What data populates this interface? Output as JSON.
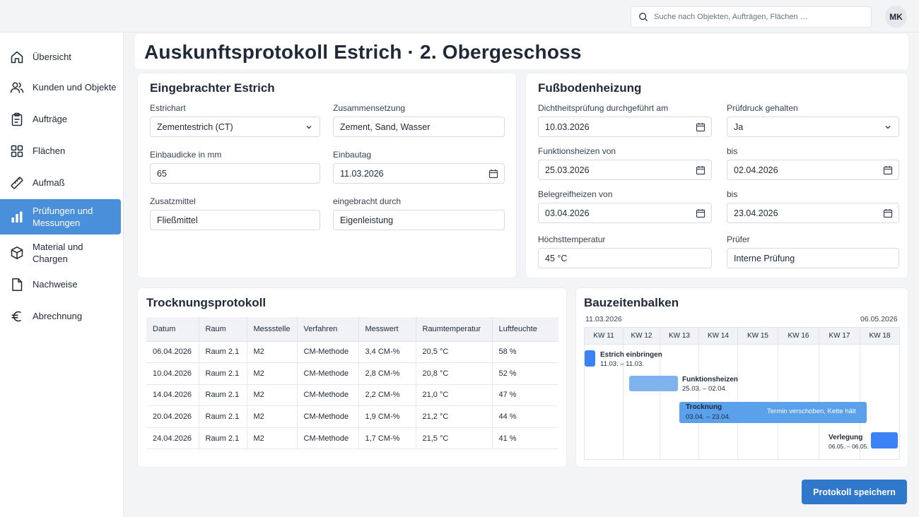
{
  "search": {
    "placeholder": "Suche nach Objekten, Aufträgen, Flächen …"
  },
  "user": {
    "initials": "MK"
  },
  "sidebar": {
    "items": [
      {
        "label": "Übersicht",
        "icon": "home-icon"
      },
      {
        "label": "Kunden und Objekte",
        "icon": "users-icon"
      },
      {
        "label": "Aufträge",
        "icon": "clipboard-icon"
      },
      {
        "label": "Flächen",
        "icon": "grid-icon"
      },
      {
        "label": "Aufmaß",
        "icon": "ruler-icon"
      },
      {
        "label": "Prüfungen und Messungen",
        "icon": "bar-chart-icon",
        "active": true
      },
      {
        "label": "Material und Chargen",
        "icon": "box-icon"
      },
      {
        "label": "Nachweise",
        "icon": "document-icon"
      },
      {
        "label": "Abrechnung",
        "icon": "euro-icon"
      }
    ]
  },
  "page": {
    "title": "Auskunftsprotokoll Estrich · 2. Obergeschoss"
  },
  "estrich": {
    "title": "Eingebrachter Estrich",
    "estrichart_label": "Estrichart",
    "estrichart_value": "Zementestrich (CT)",
    "zusammensetzung_label": "Zusammensetzung",
    "zusammensetzung_value": "Zement, Sand, Wasser",
    "einbaudicke_label": "Einbaudicke in mm",
    "einbaudicke_value": "65",
    "einbautag_label": "Einbautag",
    "einbautag_value": "11.03.2026",
    "zusatzmittel_label": "Zusatzmittel",
    "zusatzmittel_value": "Fließmittel",
    "eingebracht_label": "eingebracht durch",
    "eingebracht_value": "Eigenleistung"
  },
  "heizung": {
    "title": "Fußbodenheizung",
    "dicht_label": "Dichtheitsprüfung durchgeführt am",
    "dicht_value": "10.03.2026",
    "pruefdruck_label": "Prüfdruck gehalten",
    "pruefdruck_value": "Ja",
    "funktion_von_label": "Funktionsheizen von",
    "funktion_von_value": "25.03.2026",
    "funktion_bis_label": "bis",
    "funktion_bis_value": "02.04.2026",
    "beleg_von_label": "Belegreifheizen von",
    "beleg_von_value": "03.04.2026",
    "beleg_bis_label": "bis",
    "beleg_bis_value": "23.04.2026",
    "hoechst_label": "Höchsttemperatur",
    "hoechst_value": "45 °C",
    "pruefer_label": "Prüfer",
    "pruefer_value": "Interne Prüfung"
  },
  "trocknung": {
    "title": "Trocknungsprotokoll",
    "columns": [
      "Datum",
      "Raum",
      "Messstelle",
      "Verfahren",
      "Messwert",
      "Raumtemperatur",
      "Luftfeuchte"
    ],
    "rows": [
      [
        "06.04.2026",
        "Raum 2.1",
        "M2",
        "CM-Methode",
        "3,4 CM-%",
        "20,5 °C",
        "58 %"
      ],
      [
        "10.04.2026",
        "Raum 2.1",
        "M2",
        "CM-Methode",
        "2,8 CM-%",
        "20,8 °C",
        "52 %"
      ],
      [
        "14.04.2026",
        "Raum 2.1",
        "M2",
        "CM-Methode",
        "2,2 CM-%",
        "21,0 °C",
        "47 %"
      ],
      [
        "20.04.2026",
        "Raum 2.1",
        "M2",
        "CM-Methode",
        "1,9 CM-%",
        "21,2 °C",
        "44 %"
      ],
      [
        "24.04.2026",
        "Raum 2.1",
        "M2",
        "CM-Methode",
        "1,7 CM-%",
        "21,5 °C",
        "41 %"
      ]
    ]
  },
  "bauzeiten": {
    "title": "Bauzeitenbalken",
    "start_date": "11.03.2026",
    "end_date": "06.05.2026",
    "weeks": [
      "KW 11",
      "KW 12",
      "KW 13",
      "KW 14",
      "KW 15",
      "KW 16",
      "KW 17",
      "KW 18"
    ],
    "tasks": [
      {
        "name": "Estrich einbringen",
        "range": "11.03. – 11.03."
      },
      {
        "name": "Funktionsheizen",
        "range": "25.03. – 02.04."
      },
      {
        "name": "Trocknung",
        "range": "03.04. – 23.04.",
        "note": "Termin verschoben, Kette hält"
      },
      {
        "name": "Verlegung",
        "range": "06.05. – 06.05."
      }
    ],
    "colors": {
      "estrich": "#3b82f6",
      "funktion": "#7fb3ee",
      "trocknung": "#5ba0ea",
      "verlegung": "#3b82f6"
    }
  },
  "actions": {
    "save_label": "Protokoll speichern"
  }
}
